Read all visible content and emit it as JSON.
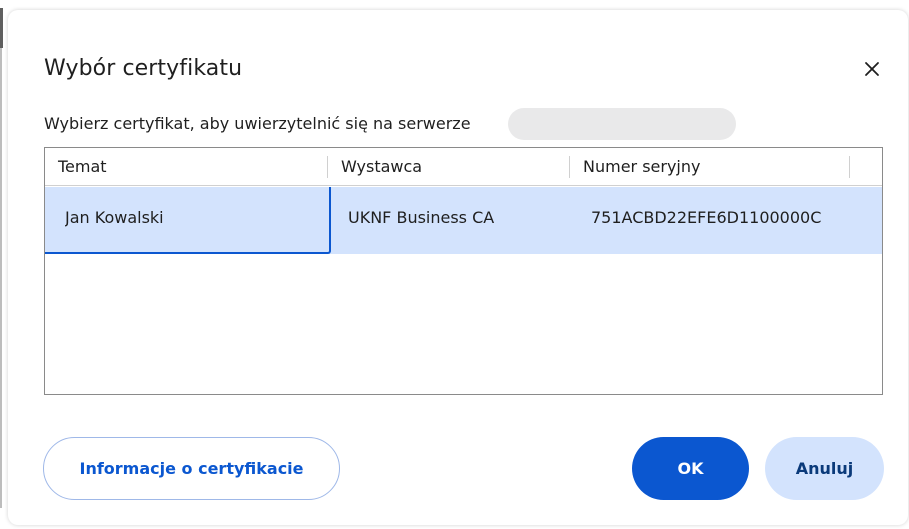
{
  "dialog": {
    "title": "Wybór certyfikatu",
    "subtitle": "Wybierz certyfikat, aby uwierzytelnić się na serwerze"
  },
  "table": {
    "columns": [
      "Temat",
      "Wystawca",
      "Numer seryjny"
    ],
    "rows": [
      {
        "subject": "Jan Kowalski",
        "issuer": "UKNF Business CA",
        "serial": "751ACBD22EFE6D1100000C"
      }
    ]
  },
  "buttons": {
    "info_label": "Informacje o certyfikacie",
    "ok_label": "OK",
    "cancel_label": "Anuluj"
  },
  "icons": {
    "close": "close-icon"
  },
  "colors": {
    "accent": "#0b57d0",
    "selection": "#d3e3fd",
    "text": "#1f1f1f"
  }
}
